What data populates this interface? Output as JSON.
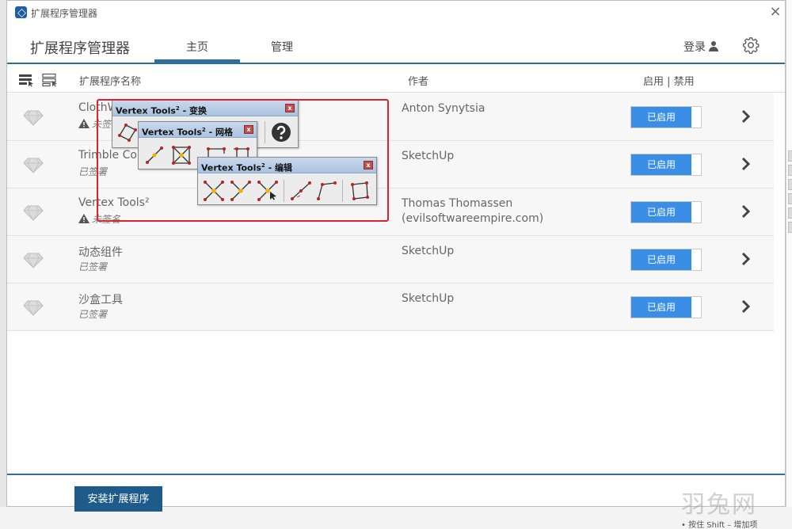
{
  "window": {
    "title": "扩展程序管理器",
    "close_label": "×"
  },
  "header": {
    "title": "扩展程序管理器",
    "tabs": [
      {
        "label": "主页"
      },
      {
        "label": "管理"
      }
    ],
    "login_label": "登录"
  },
  "columns": {
    "name": "扩展程序名称",
    "author": "作者",
    "enable": "启用 | 禁用"
  },
  "extensions": [
    {
      "name": "ClothW",
      "signature": "未签名",
      "signed": false,
      "author": "Anton Synytsia",
      "author_line2": "",
      "status": "已启用"
    },
    {
      "name": "Trimble Cor",
      "signature": "已签署",
      "signed": true,
      "author": "SketchUp",
      "author_line2": "",
      "status": "已启用"
    },
    {
      "name": "Vertex Tools²",
      "signature": "未签名",
      "signed": false,
      "author": "Thomas Thomassen",
      "author_line2": "(evilsoftwareempire.com)",
      "status": "已启用"
    },
    {
      "name": "动态组件",
      "signature": "已签署",
      "signed": true,
      "author": "SketchUp",
      "author_line2": "",
      "status": "已启用"
    },
    {
      "name": "沙盒工具",
      "signature": "已签署",
      "signed": true,
      "author": "SketchUp",
      "author_line2": "",
      "status": "已启用"
    }
  ],
  "footer": {
    "install_label": "安装扩展程序"
  },
  "toolbars": {
    "transform": {
      "title_prefix": "Vertex Tools",
      "sup": "2",
      "title_suffix": " - 变换",
      "close": "x"
    },
    "mesh": {
      "title_prefix": "Vertex Tools",
      "sup": "2",
      "title_suffix": " - 网格",
      "close": "x"
    },
    "edit": {
      "title_prefix": "Vertex Tools",
      "sup": "2",
      "title_suffix": " - 编辑",
      "close": "x"
    }
  },
  "background": {
    "bottom_text": "• 按住 Shift – 增加项",
    "watermark": "羽兔网"
  },
  "colors": {
    "accent": "#2e6f9e",
    "toggle_on": "#3a8ee6",
    "install_button": "#1e5b8b",
    "highlight_border": "#d9262c",
    "warning": "#555555"
  }
}
